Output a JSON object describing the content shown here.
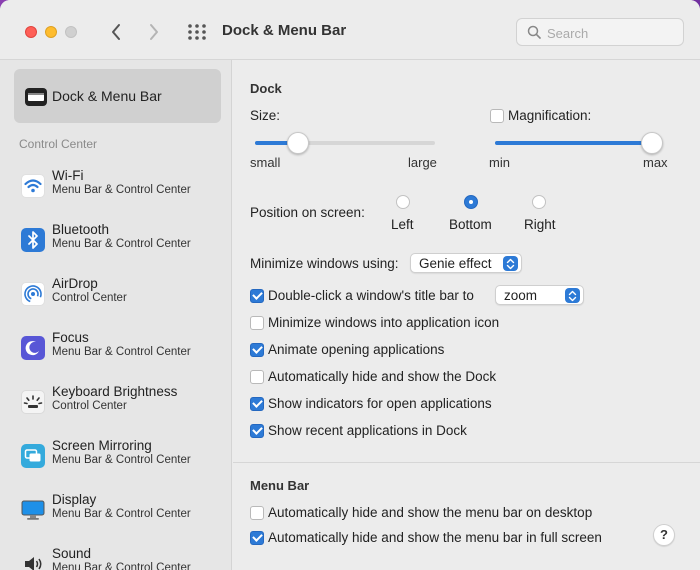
{
  "window": {
    "title": "Dock & Menu Bar"
  },
  "search": {
    "placeholder": "Search"
  },
  "sidebar": {
    "selected": {
      "label": "Dock & Menu Bar",
      "icon": "dock-icon"
    },
    "section_header": "Control Center",
    "items": [
      {
        "title": "Wi-Fi",
        "subtitle": "Menu Bar & Control Center",
        "icon": "wifi-icon"
      },
      {
        "title": "Bluetooth",
        "subtitle": "Menu Bar & Control Center",
        "icon": "bluetooth-icon"
      },
      {
        "title": "AirDrop",
        "subtitle": "Control Center",
        "icon": "airdrop-icon"
      },
      {
        "title": "Focus",
        "subtitle": "Menu Bar & Control Center",
        "icon": "moon-icon"
      },
      {
        "title": "Keyboard Brightness",
        "subtitle": "Control Center",
        "icon": "keyboard-brightness-icon"
      },
      {
        "title": "Screen Mirroring",
        "subtitle": "Menu Bar & Control Center",
        "icon": "screen-mirroring-icon"
      },
      {
        "title": "Display",
        "subtitle": "Menu Bar & Control Center",
        "icon": "display-icon"
      },
      {
        "title": "Sound",
        "subtitle": "Menu Bar & Control Center",
        "icon": "sound-icon"
      }
    ]
  },
  "dock": {
    "header": "Dock",
    "size": {
      "label": "Size:",
      "min_label": "small",
      "max_label": "large",
      "value": 0.2
    },
    "magnification": {
      "label": "Magnification:",
      "checked": false,
      "min_label": "min",
      "max_label": "max",
      "value": 1.0
    },
    "position": {
      "label": "Position on screen:",
      "options": [
        "Left",
        "Bottom",
        "Right"
      ],
      "selected": "Bottom"
    },
    "minimize": {
      "label": "Minimize windows using:",
      "value": "Genie effect"
    },
    "double_click": {
      "label": "Double-click a window's title bar to",
      "checked": true,
      "value": "zoom"
    },
    "checkboxes": [
      {
        "label": "Minimize windows into application icon",
        "checked": false
      },
      {
        "label": "Animate opening applications",
        "checked": true
      },
      {
        "label": "Automatically hide and show the Dock",
        "checked": false
      },
      {
        "label": "Show indicators for open applications",
        "checked": true
      },
      {
        "label": "Show recent applications in Dock",
        "checked": true
      }
    ]
  },
  "menubar": {
    "header": "Menu Bar",
    "checkboxes": [
      {
        "label": "Automatically hide and show the menu bar on desktop",
        "checked": false
      },
      {
        "label": "Automatically hide and show the menu bar in full screen",
        "checked": true
      }
    ]
  },
  "help": {
    "label": "?"
  },
  "colors": {
    "accent": "#2d7ad6",
    "close": "#fe5f57",
    "minimize": "#febc2e"
  }
}
